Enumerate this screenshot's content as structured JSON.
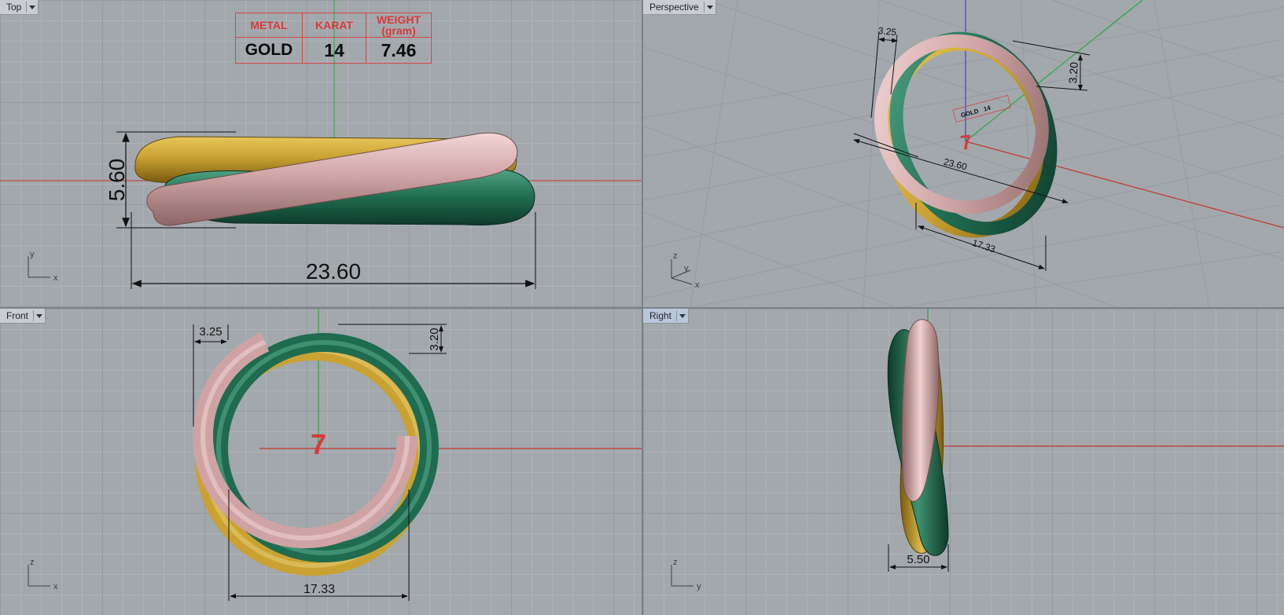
{
  "viewports": {
    "top": {
      "label": "Top"
    },
    "perspective": {
      "label": "Perspective"
    },
    "front": {
      "label": "Front"
    },
    "right": {
      "label": "Right"
    }
  },
  "info_table": {
    "headers": {
      "metal": "METAL",
      "karat": "KARAT",
      "weight": "WEIGHT",
      "weight_unit": "(gram)"
    },
    "values": {
      "metal": "GOLD",
      "karat": "14",
      "weight": "7.46"
    }
  },
  "dimensions": {
    "top_width": "23.60",
    "top_height": "5.60",
    "persp_band": "3.25",
    "persp_thickness": "3.20",
    "persp_width": "23.60",
    "persp_inner": "17.33",
    "front_band": "3.25",
    "front_thickness": "3.20",
    "front_inner": "17.33",
    "right_width": "5.50"
  },
  "ring_size": "7",
  "mini_table": {
    "metal": "GOLD",
    "karat": "14"
  },
  "axes": {
    "x": "x",
    "y": "y",
    "z": "z"
  },
  "colors": {
    "gold": "#c9a232",
    "rose": "#cfa3a3",
    "green": "#1f6b50",
    "x_axis": "#c0392b",
    "y_axis": "#27a844",
    "z_axis": "#3340d0",
    "annotation": "#d83a3a"
  }
}
